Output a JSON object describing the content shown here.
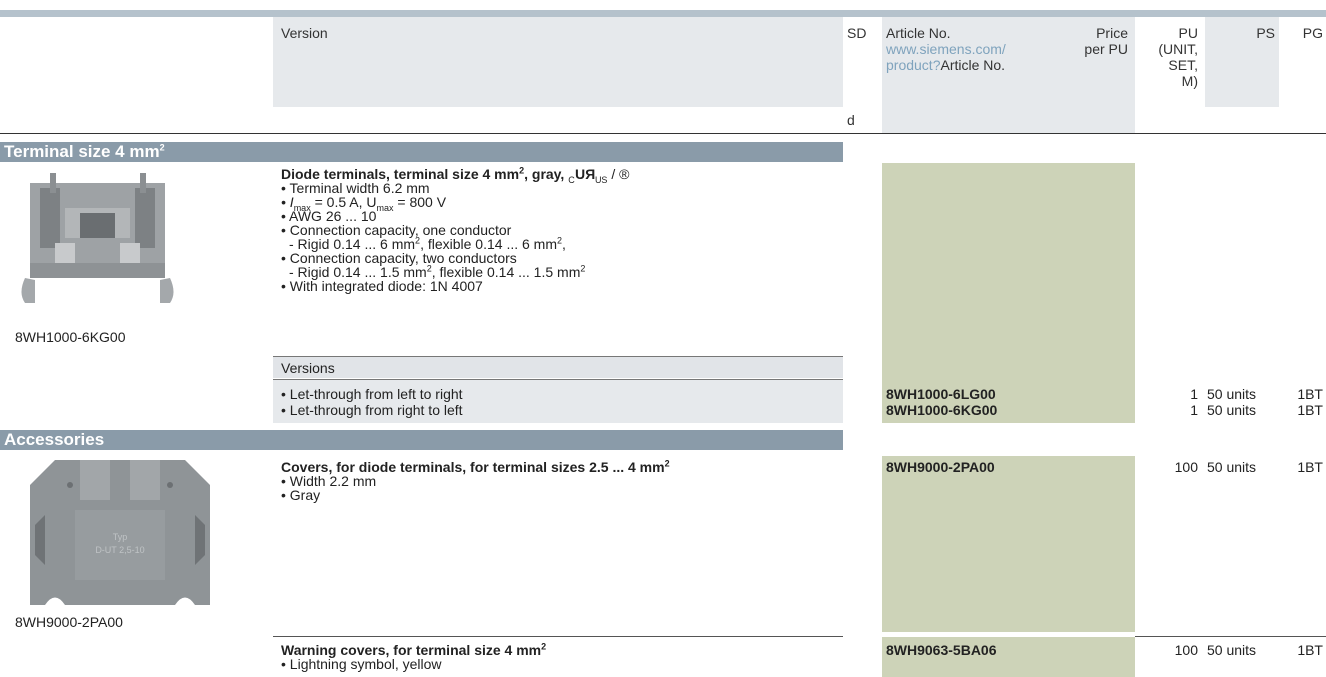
{
  "header": {
    "version": "Version",
    "sd": "SD",
    "sd_sub": "d",
    "article_label": "Article No.",
    "article_link_1": "www.siemens.com/",
    "article_link_2": "product?",
    "article_link_3": "Article No.",
    "price_1": "Price",
    "price_2": "per PU",
    "pu_1": "PU",
    "pu_2": "(UNIT,",
    "pu_3": "SET,",
    "pu_4": "M)",
    "ps": "PS",
    "pg": "PG"
  },
  "sections": {
    "terminal": "Terminal size 4 mm",
    "terminal_sup": "2",
    "accessories": "Accessories"
  },
  "diode": {
    "image_caption": "8WH1000-6KG00",
    "title": "Diode terminals, terminal size 4 mm",
    "title_sup": "2",
    "title_rest": ", gray, ",
    "cert_c": "C",
    "cert_ur": "RU",
    "cert_us": "US",
    "cert_sep": " / ",
    "cert_csa": "®",
    "b1": "• Terminal width 6.2 mm",
    "b2_a": "• I",
    "b2_max1": "max",
    "b2_b": " = 0.5 A, U",
    "b2_max2": "max",
    "b2_c": " = 800 V",
    "b3": "• AWG 26 ... 10",
    "b4": "• Connection capacity, one conductor",
    "b5_a": "- Rigid 0.14 ... 6 mm",
    "b5_sup1": "2",
    "b5_b": ", flexible 0.14 ... 6 mm",
    "b5_sup2": "2",
    "b5_c": ",",
    "b6": "• Connection capacity, two conductors",
    "b7_a": "- Rigid 0.14 ... 1.5 mm",
    "b7_sup1": "2",
    "b7_b": ", flexible 0.14 ... 1.5 mm",
    "b7_sup2": "2",
    "b8": "• With integrated diode: 1N 4007",
    "versions_label": "Versions",
    "rows": [
      {
        "label": "• Let-through from left to right",
        "article": "8WH1000-6LG00",
        "pu": "1",
        "ps": "50 units",
        "pg": "1BT"
      },
      {
        "label": "• Let-through from right to left",
        "article": "8WH1000-6KG00",
        "pu": "1",
        "ps": "50 units",
        "pg": "1BT"
      }
    ]
  },
  "covers": {
    "image_caption": "8WH9000-2PA00",
    "image_text_1": "Typ",
    "image_text_2": "D-UT 2,5-10",
    "title": "Covers, for diode terminals, for terminal sizes 2.5 ... 4 mm",
    "title_sup": "2",
    "b1": "• Width 2.2 mm",
    "b2": "• Gray",
    "article": "8WH9000-2PA00",
    "pu": "100",
    "ps": "50 units",
    "pg": "1BT"
  },
  "warning": {
    "title": "Warning covers, for terminal size 4 mm",
    "title_sup": "2",
    "b1": "• Lightning symbol, yellow",
    "article": "8WH9063-5BA06",
    "pu": "100",
    "ps": "50 units",
    "pg": "1BT"
  },
  "colors": {
    "section_bar": "#8a9ba9",
    "header_bg": "#e6e9ec",
    "article_bg": "#cdd3b8",
    "link": "#7fa3bd"
  }
}
